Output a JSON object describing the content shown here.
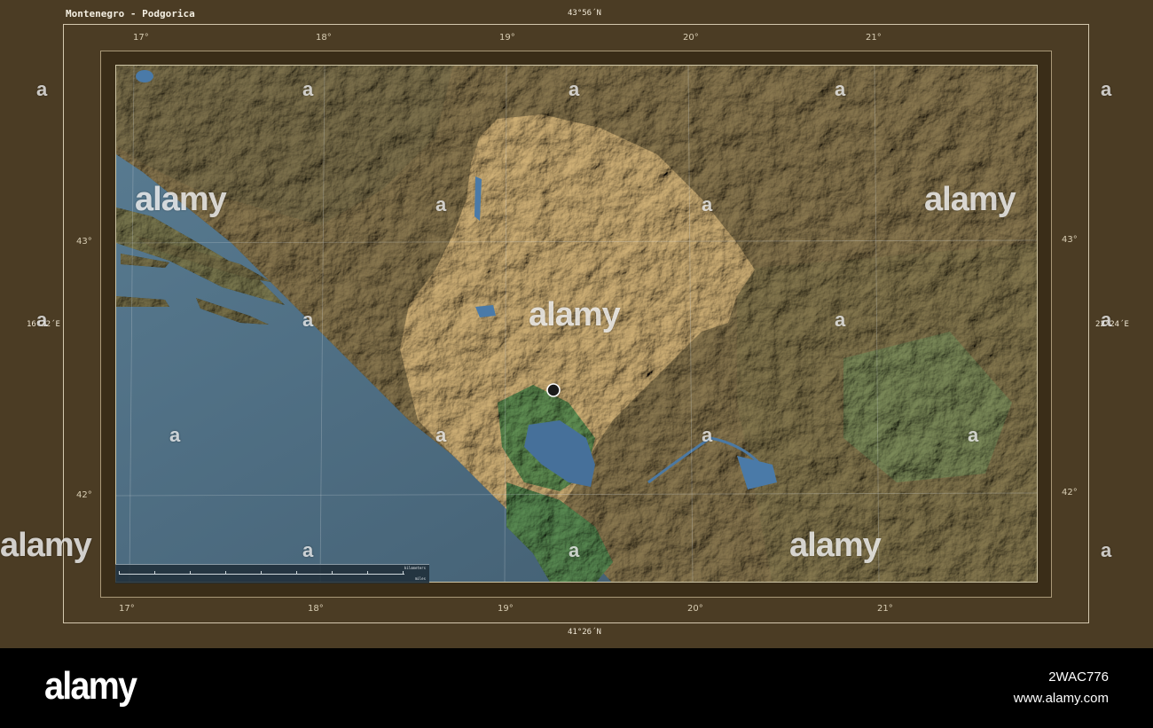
{
  "map": {
    "title": "Montenegro - Podgorica",
    "extent": {
      "north": "43°56´N",
      "south": "41°26´N",
      "west": "16°22´E",
      "east": "22°24´E"
    },
    "top_longitudes": [
      "17°",
      "18°",
      "19°",
      "20°",
      "21°"
    ],
    "bottom_longitudes": [
      "17°",
      "18°",
      "19°",
      "20°",
      "21°"
    ],
    "left_latitudes": [
      "43°",
      "42°"
    ],
    "right_latitudes": [
      "43°",
      "42°"
    ],
    "highlighted_region": "Montenegro",
    "capital_marker": "Podgorica",
    "scale": {
      "km_ticks": [
        "0",
        "15",
        "30",
        "45",
        "60",
        "75",
        "90",
        "105",
        "120"
      ],
      "km_unit": "kilometers",
      "mi_ticks": [
        "0",
        "16",
        "32",
        "48",
        "64"
      ],
      "mi_unit": "miles"
    },
    "colors": {
      "sea": "#4f6b7f",
      "land_shadowed": "#6c5f3f",
      "highlight_land": "#b59a6a",
      "lowland_green": "#4f7a48",
      "lake": "#46709a",
      "frame": "#4b3c24"
    }
  },
  "watermark": {
    "text": "alamy",
    "glyph": "a"
  },
  "footer": {
    "logo": "alamy",
    "image_id": "2WAC776",
    "url": "www.alamy.com"
  }
}
